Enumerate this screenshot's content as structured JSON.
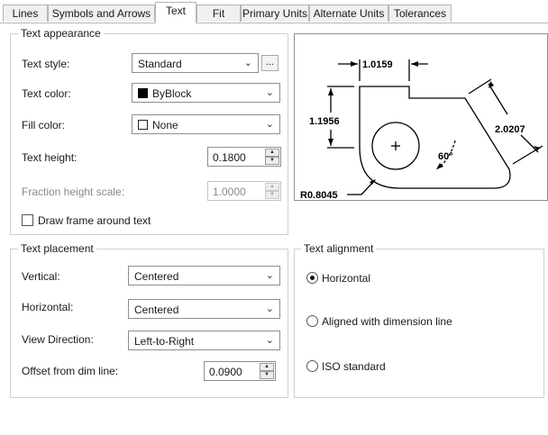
{
  "tabs": [
    {
      "label": "Lines"
    },
    {
      "label": "Symbols and Arrows"
    },
    {
      "label": "Text",
      "active": true
    },
    {
      "label": "Fit"
    },
    {
      "label": "Primary Units"
    },
    {
      "label": "Alternate Units"
    },
    {
      "label": "Tolerances"
    }
  ],
  "text_appearance": {
    "legend": "Text appearance",
    "text_style": {
      "label": "Text style:",
      "value": "Standard",
      "browse_label": "..."
    },
    "text_color": {
      "label": "Text color:",
      "value": "ByBlock",
      "swatch": "#000000"
    },
    "fill_color": {
      "label": "Fill color:",
      "value": "None"
    },
    "text_height": {
      "label": "Text height:",
      "value": "0.1800"
    },
    "fraction_height_scale": {
      "label": "Fraction height scale:",
      "value": "1.0000"
    },
    "draw_frame": {
      "label": "Draw frame around text",
      "checked": false
    }
  },
  "preview": {
    "dim_top": "1.0159",
    "dim_left": "1.1956",
    "dim_right": "2.0207",
    "angle": "60°",
    "radius": "R0.8045"
  },
  "text_placement": {
    "legend": "Text placement",
    "vertical": {
      "label": "Vertical:",
      "value": "Centered"
    },
    "horizontal": {
      "label": "Horizontal:",
      "value": "Centered"
    },
    "view_direction": {
      "label": "View Direction:",
      "value": "Left-to-Right"
    },
    "offset": {
      "label": "Offset from dim line:",
      "value": "0.0900"
    }
  },
  "text_alignment": {
    "legend": "Text alignment",
    "options": [
      {
        "label": "Horizontal",
        "selected": true
      },
      {
        "label": "Aligned with dimension line",
        "selected": false
      },
      {
        "label": "ISO standard",
        "selected": false
      }
    ]
  }
}
